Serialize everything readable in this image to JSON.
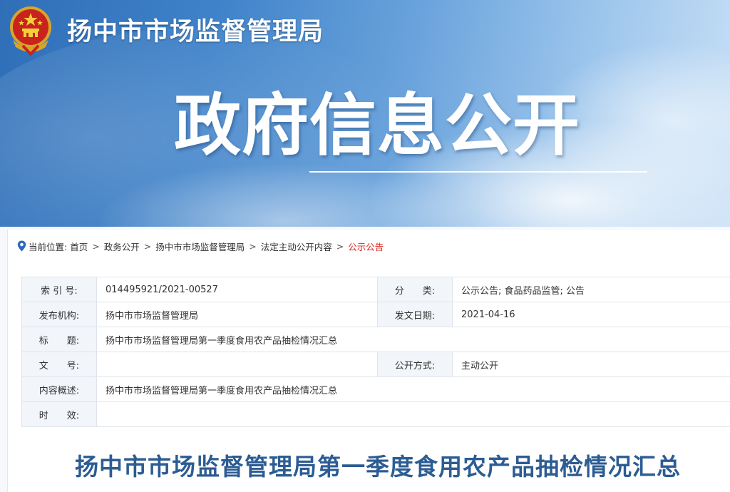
{
  "header": {
    "org_name": "扬中市市场监督管理局",
    "banner_title": "政府信息公开"
  },
  "breadcrumb": {
    "prefix": "当前位置:",
    "items": [
      "首页",
      "政务公开",
      "扬中市市场监督管理局",
      "法定主动公开内容"
    ],
    "current": "公示公告",
    "separator": ">"
  },
  "meta": {
    "index_label": "索 引 号:",
    "index_value": "014495921/2021-00527",
    "category_label": "分　　类:",
    "category_value": "公示公告;  食品药品监管;  公告",
    "publisher_label": "发布机构:",
    "publisher_value": "扬中市市场监督管理局",
    "date_label": "发文日期:",
    "date_value": "2021-04-16",
    "title_label": "标　　题:",
    "title_value": "扬中市市场监督管理局第一季度食用农产品抽检情况汇总",
    "docno_label": "文　　号:",
    "docno_value": "",
    "mode_label": "公开方式:",
    "mode_value": "主动公开",
    "summary_label": "内容概述:",
    "summary_value": "扬中市市场监督管理局第一季度食用农产品抽检情况汇总",
    "validity_label": "时　　效:",
    "validity_value": ""
  },
  "article": {
    "title": "扬中市市场监督管理局第一季度食用农产品抽检情况汇总"
  },
  "colors": {
    "banner_blue": "#3f82c9",
    "current_crumb": "#d9261c",
    "article_title": "#2c5c93",
    "label_bg": "#f2f6fb"
  },
  "icons": [
    "national-emblem-icon",
    "location-pin-icon"
  ]
}
